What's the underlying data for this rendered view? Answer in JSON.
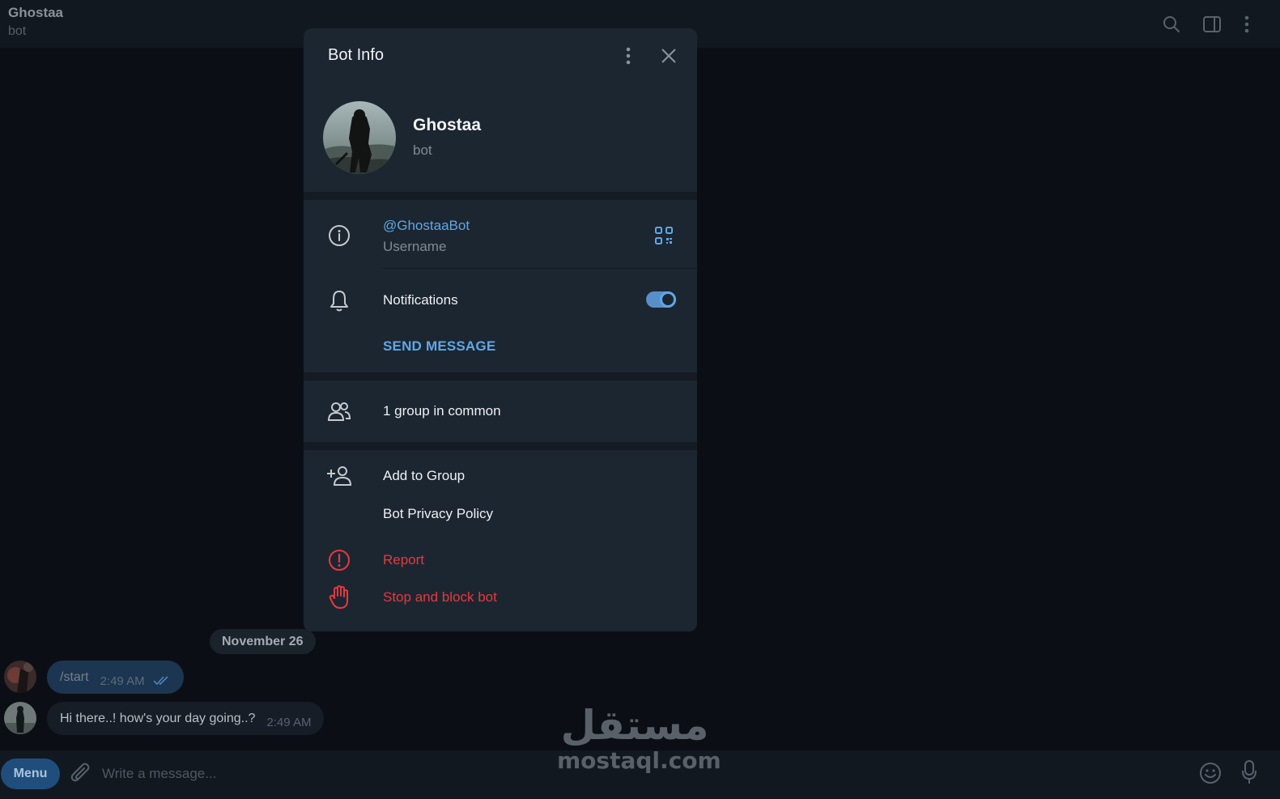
{
  "chat": {
    "title": "Ghostaa",
    "subtitle": "bot",
    "date_separator": "November 26",
    "messages": [
      {
        "direction": "out",
        "text": "/start",
        "time": "2:49 AM"
      },
      {
        "direction": "in",
        "text": "Hi there..! how's your day going..?",
        "time": "2:49 AM"
      }
    ]
  },
  "composer": {
    "menu_label": "Menu",
    "placeholder": "Write a message..."
  },
  "watermark": {
    "arabic": "مستقل",
    "latin": "mostaql.com"
  },
  "modal": {
    "title": "Bot Info",
    "profile": {
      "name": "Ghostaa",
      "subtitle": "bot"
    },
    "username": {
      "value": "@GhostaaBot",
      "label": "Username"
    },
    "notifications": {
      "label": "Notifications",
      "enabled": true
    },
    "send_message_label": "SEND MESSAGE",
    "groups_in_common": "1 group in common",
    "actions": {
      "add_to_group": "Add to Group",
      "privacy_policy": "Bot Privacy Policy",
      "report": "Report",
      "stop_block": "Stop and block bot"
    }
  },
  "colors": {
    "accent": "#5fa7e6",
    "danger": "#e5393f",
    "modal_bg": "#1c2631",
    "app_bg": "#0b0f15"
  }
}
